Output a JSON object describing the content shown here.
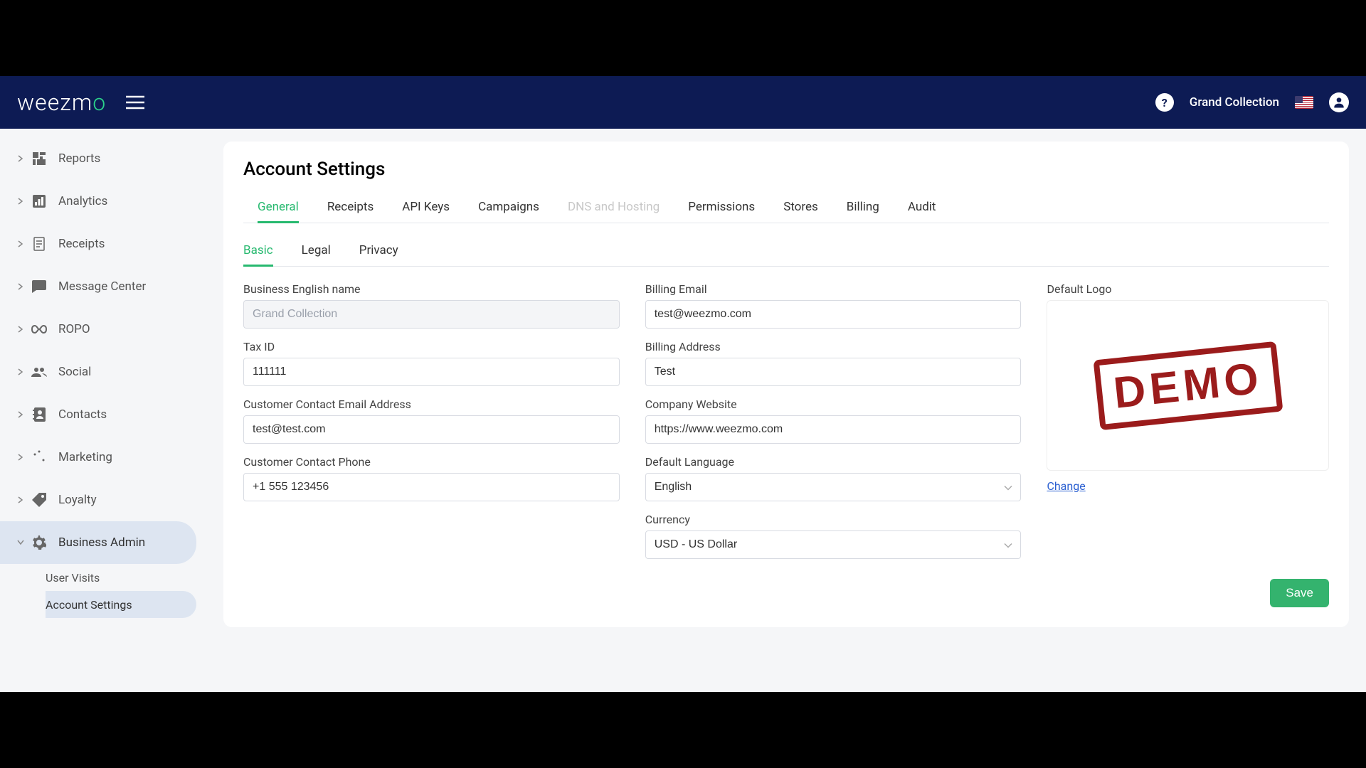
{
  "header": {
    "logo_text": "weezm",
    "logo_accent": "o",
    "org_name": "Grand Collection"
  },
  "sidebar": {
    "items": [
      {
        "label": "Reports",
        "icon": "grid"
      },
      {
        "label": "Analytics",
        "icon": "bar"
      },
      {
        "label": "Receipts",
        "icon": "receipt"
      },
      {
        "label": "Message Center",
        "icon": "message"
      },
      {
        "label": "ROPO",
        "icon": "infinity"
      },
      {
        "label": "Social",
        "icon": "people"
      },
      {
        "label": "Contacts",
        "icon": "contact"
      },
      {
        "label": "Marketing",
        "icon": "marketing"
      },
      {
        "label": "Loyalty",
        "icon": "tag"
      },
      {
        "label": "Business Admin",
        "icon": "gear",
        "active": true
      }
    ],
    "subitems": [
      {
        "label": "User Visits"
      },
      {
        "label": "Account Settings",
        "active": true
      }
    ]
  },
  "page": {
    "title": "Account Settings",
    "tabs": [
      {
        "label": "General",
        "active": true
      },
      {
        "label": "Receipts"
      },
      {
        "label": "API Keys"
      },
      {
        "label": "Campaigns"
      },
      {
        "label": "DNS and Hosting",
        "disabled": true
      },
      {
        "label": "Permissions"
      },
      {
        "label": "Stores"
      },
      {
        "label": "Billing"
      },
      {
        "label": "Audit"
      }
    ],
    "subtabs": [
      {
        "label": "Basic",
        "active": true
      },
      {
        "label": "Legal"
      },
      {
        "label": "Privacy"
      }
    ]
  },
  "form": {
    "left": {
      "business_name": {
        "label": "Business English name",
        "placeholder": "Grand Collection",
        "value": ""
      },
      "tax_id": {
        "label": "Tax ID",
        "value": "111111"
      },
      "contact_email": {
        "label": "Customer Contact Email Address",
        "value": "test@test.com"
      },
      "contact_phone": {
        "label": "Customer Contact Phone",
        "value": "+1 555 123456"
      }
    },
    "middle": {
      "billing_email": {
        "label": "Billing Email",
        "value": "test@weezmo.com"
      },
      "billing_address": {
        "label": "Billing Address",
        "value": "Test"
      },
      "website": {
        "label": "Company Website",
        "value": "https://www.weezmo.com"
      },
      "language": {
        "label": "Default Language",
        "value": "English"
      },
      "currency": {
        "label": "Currency",
        "value": "USD - US Dollar"
      }
    },
    "right": {
      "logo_label": "Default Logo",
      "stamp_text": "DEMO",
      "change_label": "Change"
    },
    "save_label": "Save"
  }
}
